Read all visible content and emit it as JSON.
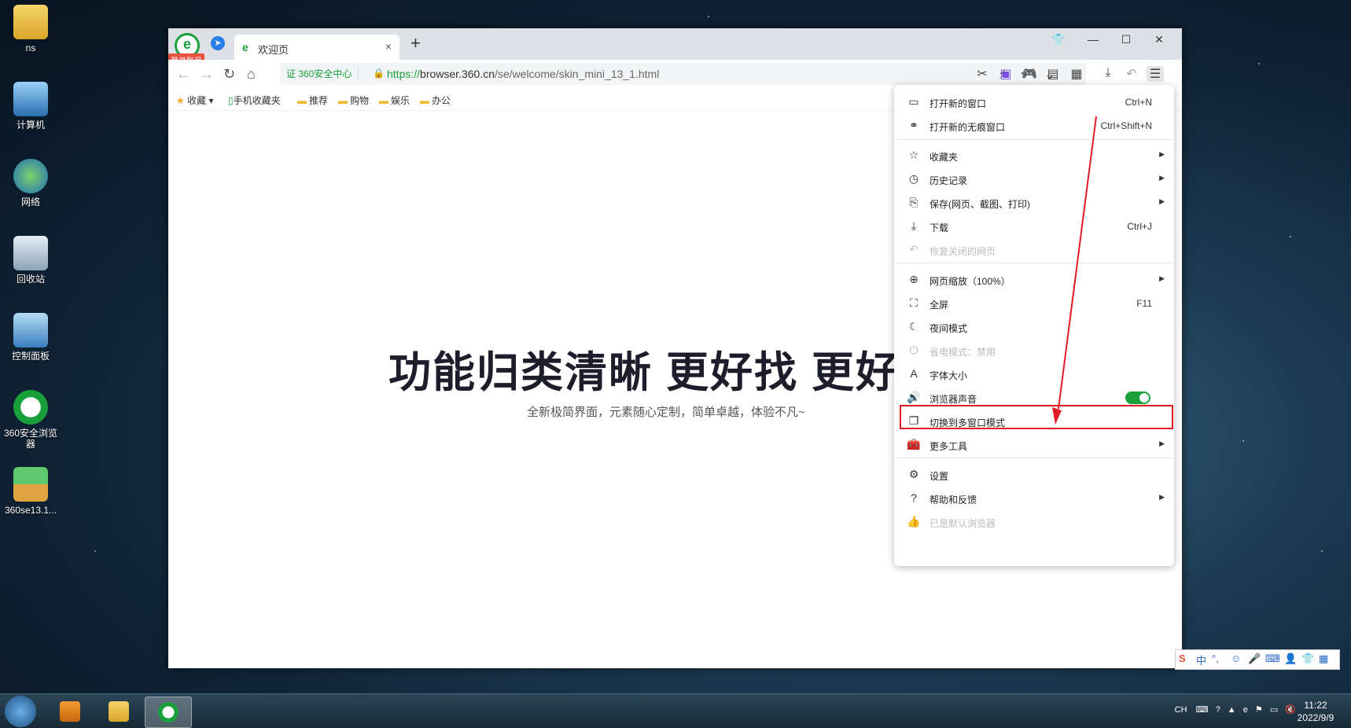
{
  "desktop": {
    "icons": [
      {
        "label": "ns"
      },
      {
        "label": "计算机"
      },
      {
        "label": "网络"
      },
      {
        "label": "回收站"
      },
      {
        "label": "控制面板"
      },
      {
        "label": "360安全浏览器"
      },
      {
        "label": "360se13.1..."
      }
    ]
  },
  "browser": {
    "login_badge": "登录账号",
    "tab": {
      "title": "欢迎页",
      "close": "×"
    },
    "new_tab": "+",
    "cert_label": "证 360安全中心",
    "url": {
      "scheme": "https://",
      "host": "browser.360.cn",
      "path": "/se/welcome/skin_mini_13_1.html"
    },
    "bookmarks": [
      {
        "label": "收藏"
      },
      {
        "label": "手机收藏夹"
      },
      {
        "label": "推荐"
      },
      {
        "label": "购物"
      },
      {
        "label": "娱乐"
      },
      {
        "label": "办公"
      }
    ],
    "page": {
      "headline": "功能归类清晰  更好找  更好",
      "subline": "全新极简界面，元素随心定制，简单卓越，体验不凡~"
    }
  },
  "menu": {
    "items": [
      {
        "icon": "window-icon",
        "label": "打开新的窗口",
        "shortcut": "Ctrl+N"
      },
      {
        "icon": "incognito-icon",
        "label": "打开新的无痕窗口",
        "shortcut": "Ctrl+Shift+N"
      },
      {
        "icon": "star-icon",
        "label": "收藏夹"
      },
      {
        "icon": "clock-icon",
        "label": "历史记录"
      },
      {
        "icon": "save-icon",
        "label": "保存(网页、截图、打印)"
      },
      {
        "icon": "download-icon",
        "label": "下载",
        "shortcut": "Ctrl+J"
      },
      {
        "icon": "undo-icon",
        "label": "恢复关闭的网页"
      },
      {
        "icon": "zoom-icon",
        "label": "网页缩放（100%）"
      },
      {
        "icon": "fullscreen-icon",
        "label": "全屏",
        "shortcut": "F11"
      },
      {
        "icon": "moon-icon",
        "label": "夜间模式"
      },
      {
        "icon": "power-icon",
        "label": "省电模式：禁用"
      },
      {
        "icon": "font-icon",
        "label": "字体大小"
      },
      {
        "icon": "speaker-icon",
        "label": "浏览器声音"
      },
      {
        "icon": "multi-window-icon",
        "label": "切换到多窗口模式"
      },
      {
        "icon": "toolbox-icon",
        "label": "更多工具"
      },
      {
        "icon": "gear-icon",
        "label": "设置"
      },
      {
        "icon": "help-icon",
        "label": "帮助和反馈"
      },
      {
        "icon": "thumb-icon",
        "label": "已是默认浏览器"
      }
    ],
    "sound_enabled": true
  },
  "ime": {
    "label": "中"
  },
  "taskbar": {
    "tray_lang": "CH",
    "time": "11:22",
    "date": "2022/9/9"
  },
  "colors": {
    "accent": "#19a03b",
    "highlight": "#e01b24"
  }
}
